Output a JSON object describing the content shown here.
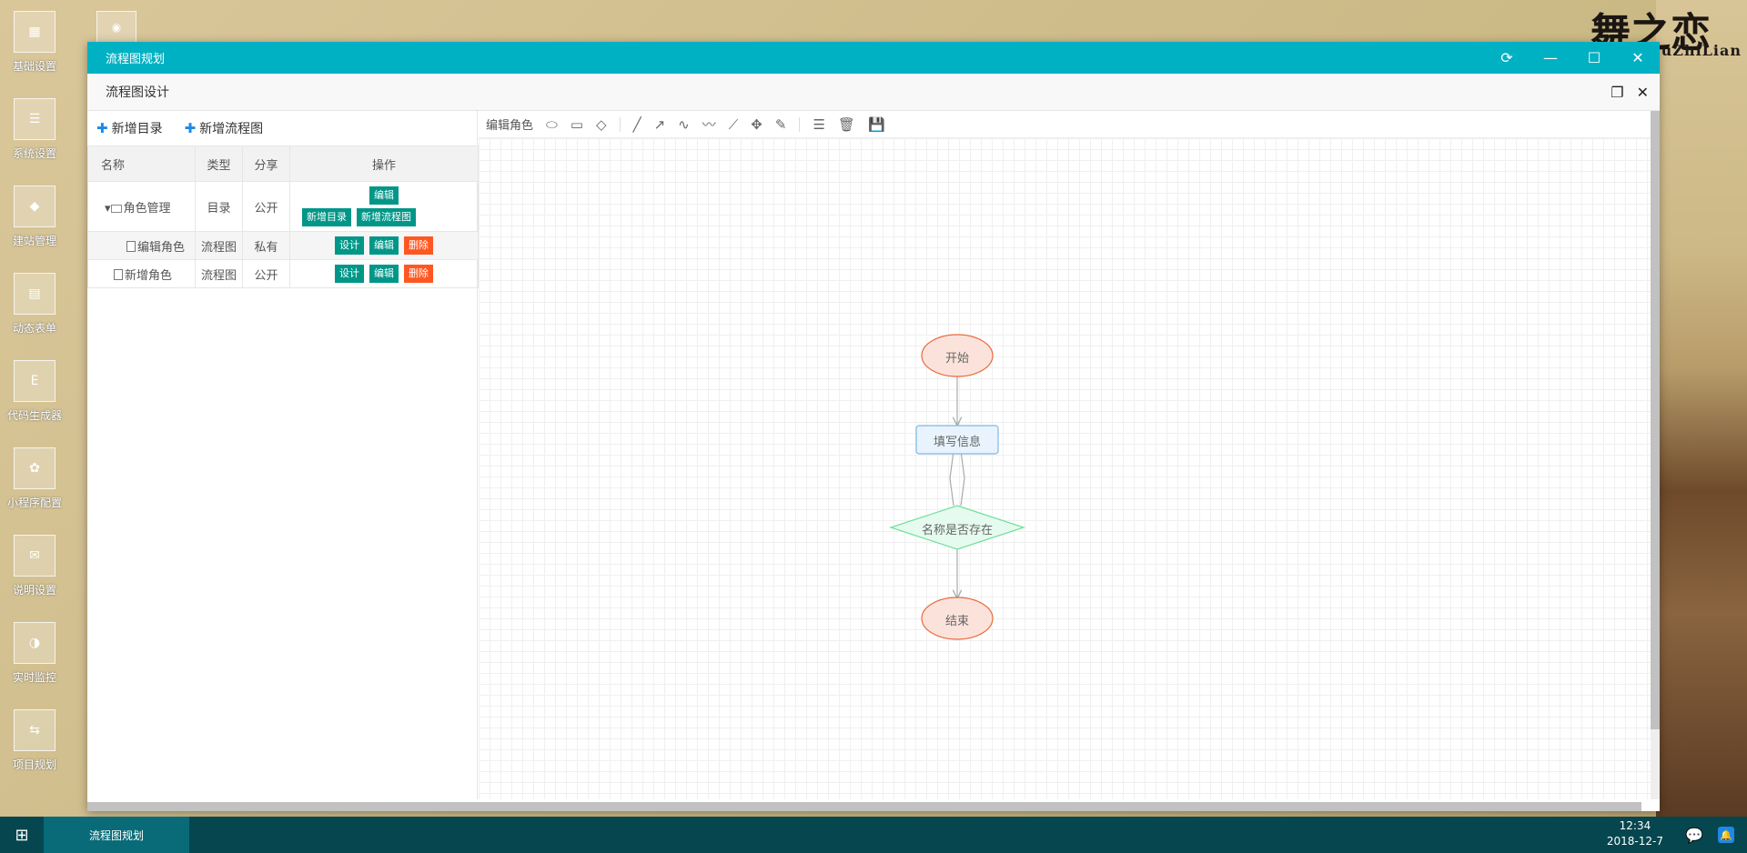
{
  "desktop": {
    "brand": "WuZhiLian",
    "calligraphy": "舞之恋",
    "icons": [
      {
        "label": "基础设置",
        "glyph": "▦"
      },
      {
        "label": "系统设置",
        "glyph": "☰"
      },
      {
        "label": "建站管理",
        "glyph": "◆"
      },
      {
        "label": "动态表单",
        "glyph": "▤"
      },
      {
        "label": "代码生成器",
        "glyph": "E"
      },
      {
        "label": "小程序配置",
        "glyph": "✿"
      },
      {
        "label": "说明设置",
        "glyph": "✉"
      },
      {
        "label": "实时监控",
        "glyph": "◑"
      },
      {
        "label": "项目规划",
        "glyph": "⇆"
      }
    ]
  },
  "window": {
    "title": "流程图规划",
    "subtitle": "流程图设计",
    "controls": [
      "⟳",
      "—",
      "☐",
      "✕"
    ],
    "sub_controls": [
      "❐",
      "✕"
    ]
  },
  "left": {
    "add_dir": "新增目录",
    "add_flow": "新增流程图",
    "columns": [
      "名称",
      "类型",
      "分享",
      "操作"
    ],
    "rows": [
      {
        "name": "角色管理",
        "type": "目录",
        "share": "公开",
        "actions": [
          "编辑",
          "新增目录",
          "新增流程图"
        ]
      },
      {
        "name": "编辑角色",
        "type": "流程图",
        "share": "私有",
        "actions": [
          "设计",
          "编辑",
          "删除"
        ]
      },
      {
        "name": "新增角色",
        "type": "流程图",
        "share": "公开",
        "actions": [
          "设计",
          "编辑",
          "删除"
        ]
      }
    ]
  },
  "designer": {
    "title": "编辑角色",
    "nodes": {
      "start": "开始",
      "fill": "填写信息",
      "decision": "名称是否存在",
      "end": "结束"
    }
  },
  "taskbar": {
    "task": "流程图规划",
    "time": "12:34",
    "date": "2018-12-7"
  }
}
